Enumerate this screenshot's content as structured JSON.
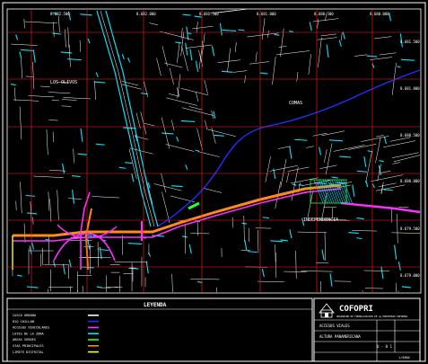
{
  "colors": {
    "background": "#000000",
    "grid": "#ff2020",
    "streets": "#ffffff",
    "blocks": "#00e5ff",
    "river": "#2030ff",
    "road_magenta": "#ff30ff",
    "road_orange": "#ff8a1e",
    "green": "#20ff40",
    "yellow": "#ffff00",
    "frame": "#ffffff"
  },
  "districts": [
    {
      "id": "los-olivos",
      "label": "LOS OLIVOS"
    },
    {
      "id": "comas",
      "label": "COMAS"
    },
    {
      "id": "independencia",
      "label": "INDEPENDENCIA"
    }
  ],
  "grid_labels": {
    "top": [
      "8.682.500",
      "8.682.000",
      "8.681.500",
      "8.681.000",
      "8.680.500",
      "8.680.000"
    ],
    "right": [
      "8.681.500",
      "8.681.000",
      "8.680.500",
      "8.680.000",
      "8.679.500",
      "8.679.000",
      "8.678.500"
    ]
  },
  "legend": {
    "title": "LEYENDA",
    "items": [
      {
        "label": "CASCO URBANO",
        "swatch": "#ffffff"
      },
      {
        "label": "RIO CHILLON",
        "swatch": "#2030ff"
      },
      {
        "label": "ACCESOS VEHICULARES",
        "swatch": "#ff30ff"
      },
      {
        "label": "LOTES DE LA ZONA",
        "swatch": "#00e5ff"
      },
      {
        "label": "AREAS VERDES",
        "swatch": "#20ff40"
      },
      {
        "label": "VIAS PRINCIPALES",
        "swatch": "#ff8a1e"
      },
      {
        "label": "LIMITE DISTRITAL",
        "swatch": "#ffff00"
      }
    ]
  },
  "title_block": {
    "org": "COFOPRI",
    "subtitle": "ORGANISMO DE FORMALIZACION DE LA PROPIEDAD INFORMAL",
    "row1": "ACCESOS VIALES",
    "row2": "ALTURA PANAMERICANA",
    "sheet_code": "U - 0 1",
    "scale": "1/5000"
  }
}
